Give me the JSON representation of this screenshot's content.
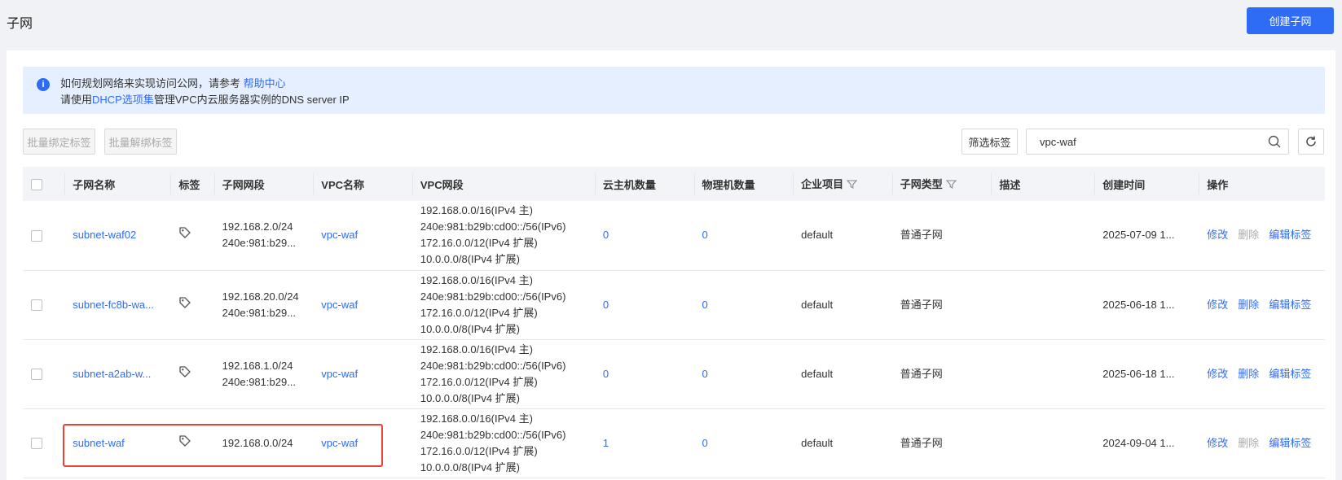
{
  "page": {
    "title": "子网",
    "create_button": "创建子网"
  },
  "notice": {
    "line1_prefix": "如何规划网络来实现访问公网，请参考 ",
    "line1_link": "帮助中心",
    "line2_prefix": "请使用",
    "line2_link": "DHCP选项集",
    "line2_suffix": "管理VPC内云服务器实例的DNS server IP"
  },
  "toolbar": {
    "bind_tags": "批量绑定标签",
    "unbind_tags": "批量解绑标签",
    "filter_tags": "筛选标签",
    "search_value": "vpc-waf"
  },
  "columns": {
    "name": "子网名称",
    "tags": "标签",
    "cidr": "子网网段",
    "vpc_name": "VPC名称",
    "vpc_cidr": "VPC网段",
    "cvm_count": "云主机数量",
    "bm_count": "物理机数量",
    "project": "企业项目",
    "type": "子网类型",
    "desc": "描述",
    "created": "创建时间",
    "actions": "操作"
  },
  "actions": {
    "edit": "修改",
    "delete": "删除",
    "edit_tags": "编辑标签"
  },
  "rows": [
    {
      "name": "subnet-waf02",
      "cidr1": "192.168.2.0/24",
      "cidr2": "240e:981:b29...",
      "vpc": "vpc-waf",
      "vpc_cidr": [
        "192.168.0.0/16(IPv4 主)",
        "240e:981:b29b:cd00::/56(IPv6)",
        "172.16.0.0/12(IPv4 扩展)",
        "10.0.0.0/8(IPv4 扩展)"
      ],
      "cvm": "0",
      "bm": "0",
      "project": "default",
      "type": "普通子网",
      "desc": "",
      "created": "2025-07-09 1...",
      "delete_enabled": false
    },
    {
      "name": "subnet-fc8b-wa...",
      "cidr1": "192.168.20.0/24",
      "cidr2": "240e:981:b29...",
      "vpc": "vpc-waf",
      "vpc_cidr": [
        "192.168.0.0/16(IPv4 主)",
        "240e:981:b29b:cd00::/56(IPv6)",
        "172.16.0.0/12(IPv4 扩展)",
        "10.0.0.0/8(IPv4 扩展)"
      ],
      "cvm": "0",
      "bm": "0",
      "project": "default",
      "type": "普通子网",
      "desc": "",
      "created": "2025-06-18 1...",
      "delete_enabled": true
    },
    {
      "name": "subnet-a2ab-w...",
      "cidr1": "192.168.1.0/24",
      "cidr2": "240e:981:b29...",
      "vpc": "vpc-waf",
      "vpc_cidr": [
        "192.168.0.0/16(IPv4 主)",
        "240e:981:b29b:cd00::/56(IPv6)",
        "172.16.0.0/12(IPv4 扩展)",
        "10.0.0.0/8(IPv4 扩展)"
      ],
      "cvm": "0",
      "bm": "0",
      "project": "default",
      "type": "普通子网",
      "desc": "",
      "created": "2025-06-18 1...",
      "delete_enabled": true
    },
    {
      "name": "subnet-waf",
      "cidr1": "192.168.0.0/24",
      "cidr2": "",
      "vpc": "vpc-waf",
      "vpc_cidr": [
        "192.168.0.0/16(IPv4 主)",
        "240e:981:b29b:cd00::/56(IPv6)",
        "172.16.0.0/12(IPv4 扩展)",
        "10.0.0.0/8(IPv4 扩展)"
      ],
      "cvm": "1",
      "bm": "0",
      "project": "default",
      "type": "普通子网",
      "desc": "",
      "created": "2024-09-04 1...",
      "delete_enabled": false
    }
  ],
  "colors": {
    "primary": "#2f6cf6",
    "notice_bg": "#e5efff",
    "highlight": "#e8413a"
  },
  "icons": [
    "info-icon",
    "search-icon",
    "refresh-icon",
    "tag-icon",
    "filter-icon"
  ]
}
